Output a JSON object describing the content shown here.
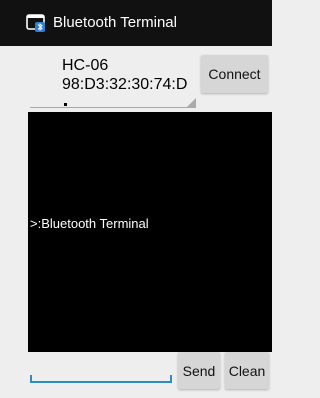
{
  "titlebar": {
    "app_title": "Bluetooth Terminal",
    "app_icon": "bluetooth-terminal-icon",
    "background": "#111111"
  },
  "device": {
    "name": "HC-06",
    "address": "98:D3:32:30:74:D"
  },
  "buttons": {
    "connect_label": "Connect",
    "send_label": "Send",
    "clean_label": "Clean"
  },
  "terminal": {
    "line": ">:Bluetooth Terminal",
    "background": "#000000"
  },
  "input": {
    "value": "",
    "accent_color": "#2c8ec2"
  }
}
